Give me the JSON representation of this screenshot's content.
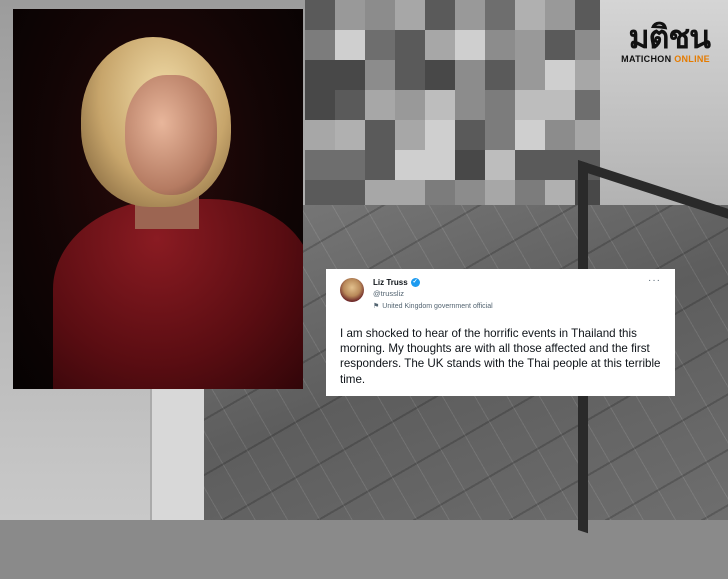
{
  "logo": {
    "thai_text": "มติชน",
    "sub_text": "MATICHON",
    "sub_accent": "ONLINE"
  },
  "tweet": {
    "display_name": "Liz Truss",
    "handle": "@trussliz",
    "label": "United Kingdom government official",
    "body": "I am shocked to hear of the horrific events in Thailand this morning. My thoughts are with all those affected and the first responders. The UK stands with the Thai people at this terrible time.",
    "more_icon": "more-options-icon",
    "verified_icon": "verified-badge-icon",
    "label_icon": "flag-icon"
  }
}
